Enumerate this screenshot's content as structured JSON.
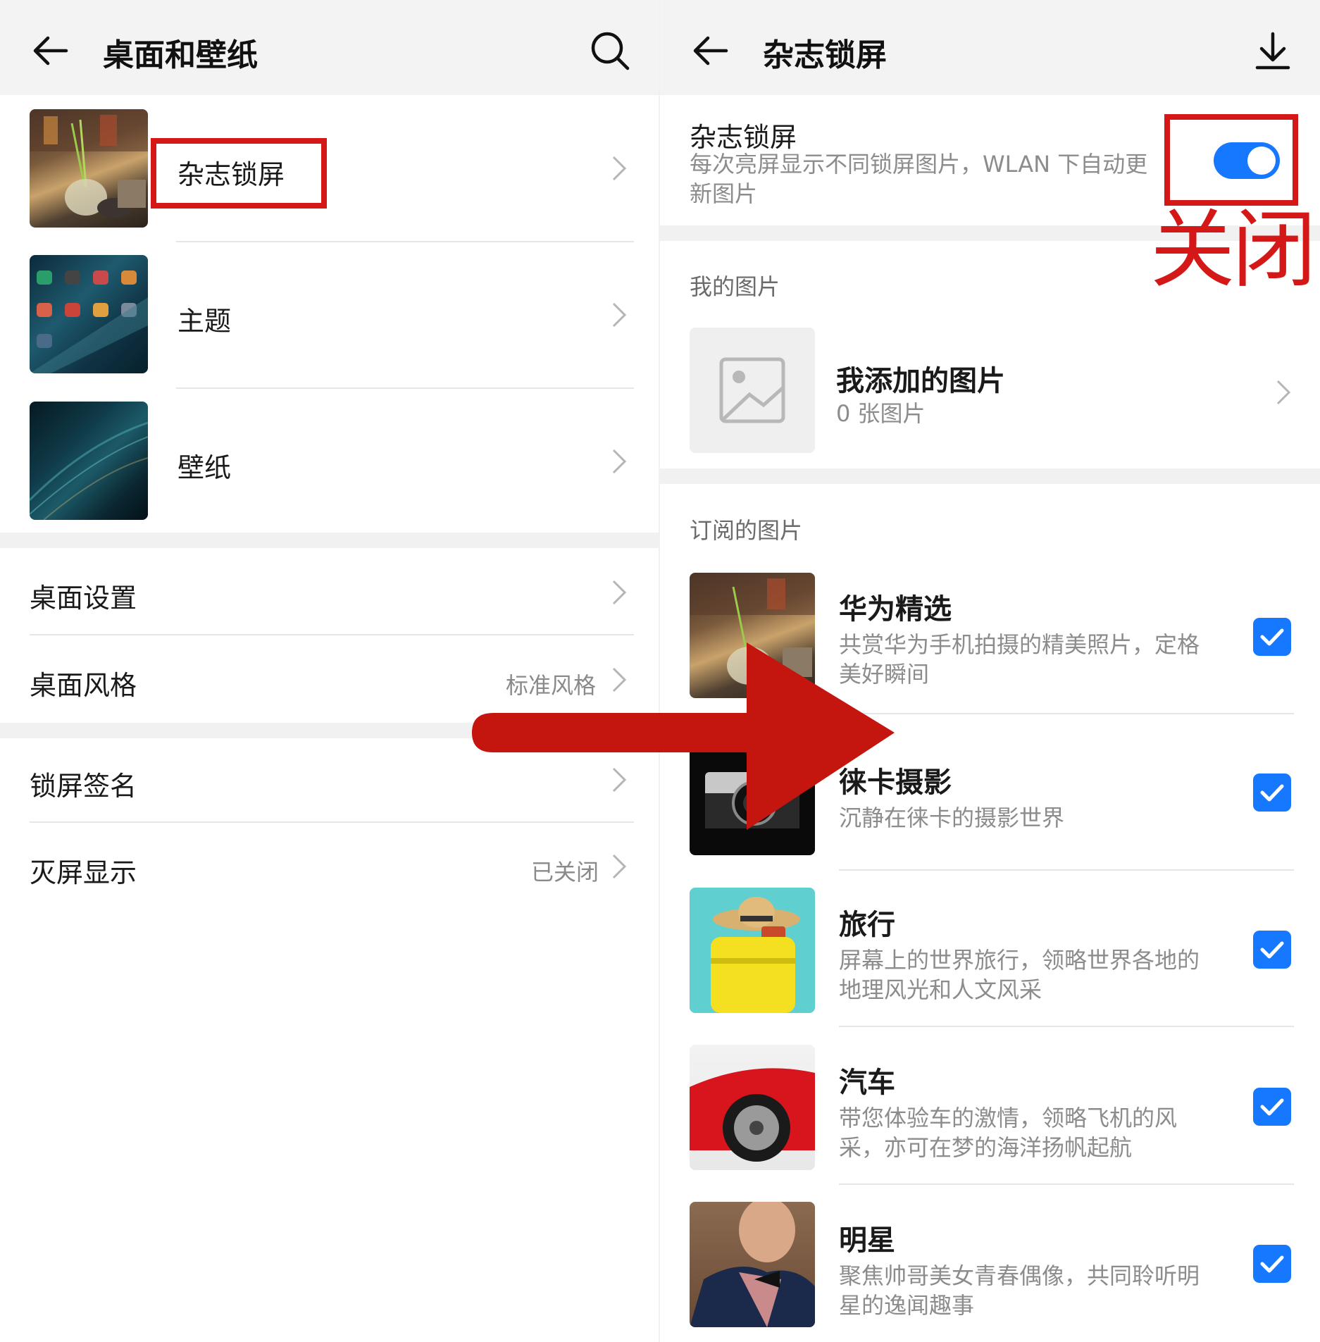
{
  "left": {
    "header": {
      "title": "桌面和壁纸"
    },
    "image_items": [
      {
        "label": "杂志锁屏"
      },
      {
        "label": "主题"
      },
      {
        "label": "壁纸"
      }
    ],
    "settings_group1": [
      {
        "label": "桌面设置",
        "value": ""
      },
      {
        "label": "桌面风格",
        "value": "标准风格"
      }
    ],
    "settings_group2": [
      {
        "label": "锁屏签名",
        "value": ""
      },
      {
        "label": "灭屏显示",
        "value": "已关闭"
      }
    ]
  },
  "right": {
    "header": {
      "title": "杂志锁屏"
    },
    "master": {
      "title": "杂志锁屏",
      "desc_line1": "每次亮屏显示不同锁屏图片，WLAN 下自动更",
      "desc_line2": "新图片",
      "enabled": true
    },
    "my_pictures": {
      "section": "我的图片",
      "item_title": "我添加的图片",
      "item_count": "0 张图片"
    },
    "subscribed": {
      "section": "订阅的图片",
      "items": [
        {
          "title": "华为精选",
          "line1": "共赏华为手机拍摄的精美照片，定格",
          "line2": "美好瞬间",
          "checked": true
        },
        {
          "title": "徕卡摄影",
          "line1": "沉静在徕卡的摄影世界",
          "line2": "",
          "checked": true
        },
        {
          "title": "旅行",
          "line1": "屏幕上的世界旅行，领略世界各地的",
          "line2": "地理风光和人文风采",
          "checked": true
        },
        {
          "title": "汽车",
          "line1": "带您体验车的激情，领略飞机的风",
          "line2": "采，亦可在梦的海洋扬帆起航",
          "checked": true
        },
        {
          "title": "明星",
          "line1": "聚焦帅哥美女青春偶像，共同聆听明",
          "line2": "星的逸闻趣事",
          "checked": true
        }
      ]
    }
  },
  "annotation": {
    "text": "关闭",
    "color": "#d41717"
  },
  "colors": {
    "accent": "#1677ff",
    "annotation_red": "#d41717",
    "header_bg": "#f3f3f3"
  }
}
